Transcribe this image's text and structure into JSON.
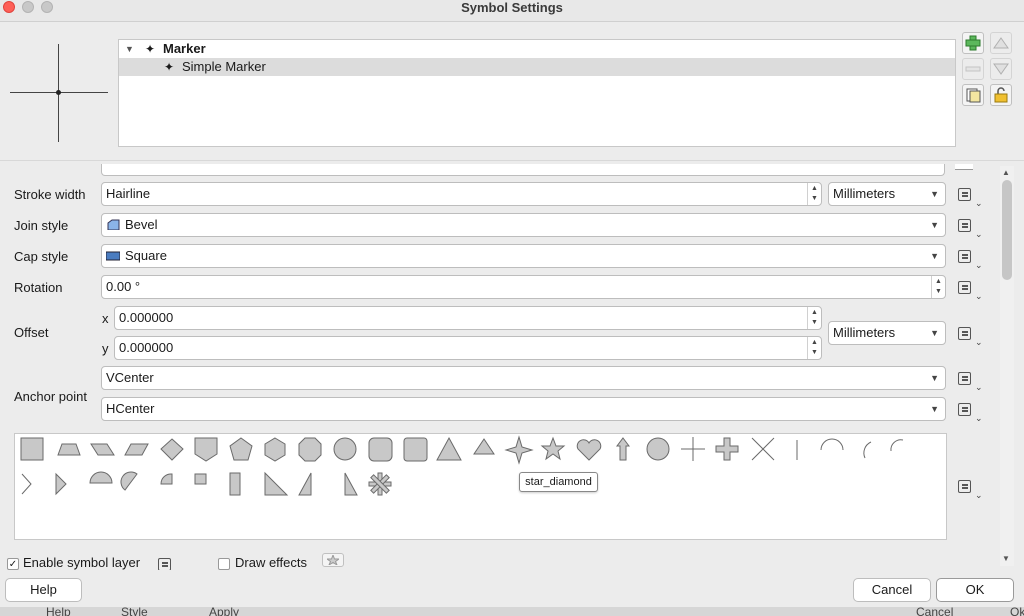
{
  "window": {
    "title": "Symbol Settings"
  },
  "tree": {
    "items": [
      {
        "label": "Marker",
        "level": 0
      },
      {
        "label": "Simple Marker",
        "level": 1
      }
    ]
  },
  "properties": {
    "stroke_width": {
      "label": "Stroke width",
      "value": "Hairline",
      "unit": "Millimeters"
    },
    "join_style": {
      "label": "Join style",
      "value": "Bevel"
    },
    "cap_style": {
      "label": "Cap style",
      "value": "Square"
    },
    "rotation": {
      "label": "Rotation",
      "value": "0.00 °"
    },
    "offset": {
      "label": "Offset",
      "x_label": "x",
      "x": "0.000000",
      "y_label": "y",
      "y": "0.000000",
      "unit": "Millimeters"
    },
    "anchor": {
      "label": "Anchor point",
      "vertical": "VCenter",
      "horizontal": "HCenter"
    }
  },
  "gallery": {
    "tooltip": "star_diamond",
    "shapes": [
      "square",
      "trapezoid",
      "parallelogram-right",
      "parallelogram-left",
      "diamond",
      "shield",
      "pentagon",
      "hexagon",
      "octagon",
      "circle-large",
      "rounded-square",
      "rounded-square-2",
      "triangle",
      "triangle-small",
      "star-diamond",
      "star",
      "heart",
      "arrow-up",
      "circle",
      "cross",
      "cross-fill",
      "x-cross",
      "line",
      "arc",
      "half-arc",
      "quarter-arc",
      "arrowhead",
      "filled-arrowhead",
      "semi-circle",
      "third-circle",
      "quarter-circle",
      "quarter-square",
      "half-square",
      "right-half-triangle",
      "left-half-triangle",
      "half-triangle-small",
      "asterisk-fill"
    ]
  },
  "options": {
    "enable_symbol_layer": {
      "label": "Enable symbol layer",
      "checked": true
    },
    "draw_effects": {
      "label": "Draw effects",
      "checked": false
    }
  },
  "buttons": {
    "help": "Help",
    "cancel": "Cancel",
    "ok": "OK"
  },
  "background": {
    "help": "Help",
    "style": "Style",
    "apply": "Apply",
    "cancel": "Cancel",
    "ok": "Ok"
  }
}
